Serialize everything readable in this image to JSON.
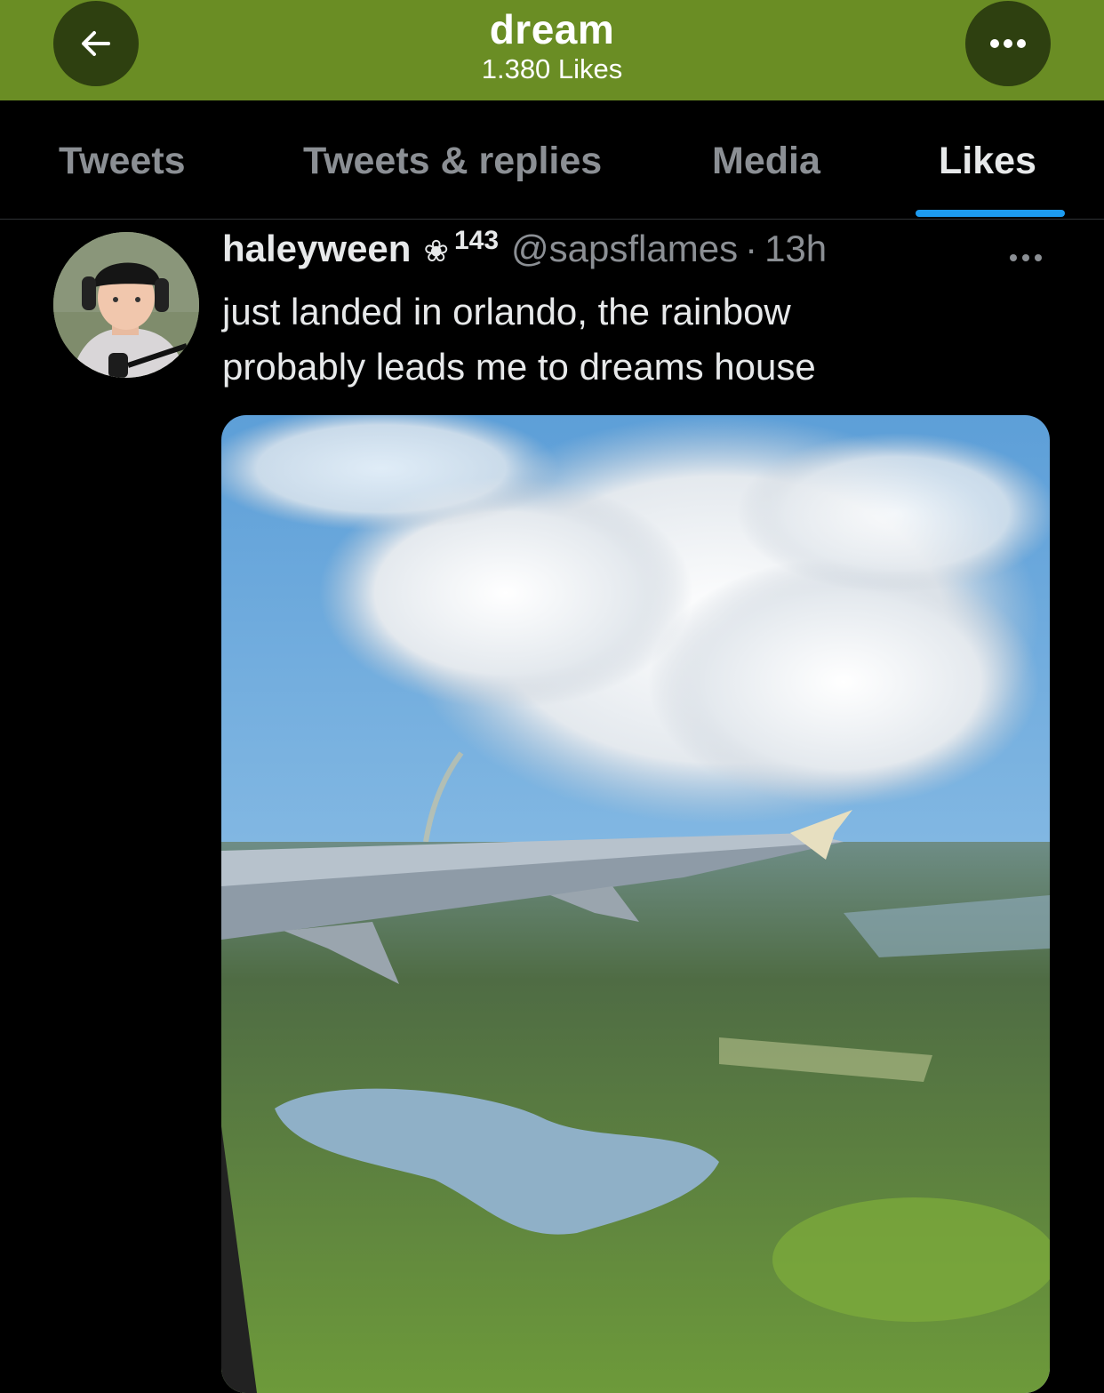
{
  "header": {
    "title": "dream",
    "subtitle": "1.380 Likes",
    "back_icon": "arrow-left-icon",
    "more_icon": "ellipsis-icon",
    "background_color": "#6a8d24"
  },
  "tabs": [
    {
      "label": "Tweets",
      "active": false
    },
    {
      "label": "Tweets & replies",
      "active": false
    },
    {
      "label": "Media",
      "active": false
    },
    {
      "label": "Likes",
      "active": true
    }
  ],
  "accent_color": "#1d9bf0",
  "tweet": {
    "display_name": "haleyween",
    "name_badge": "❀",
    "name_number": "143",
    "handle": "@sapsflames",
    "separator": "·",
    "time": "13h",
    "more_icon": "ellipsis-icon",
    "text_lines": [
      "just landed in orlando, the rainbow",
      "probably leads me to dreams house"
    ],
    "media_description_icon": "photo-airplane-window-icon"
  }
}
